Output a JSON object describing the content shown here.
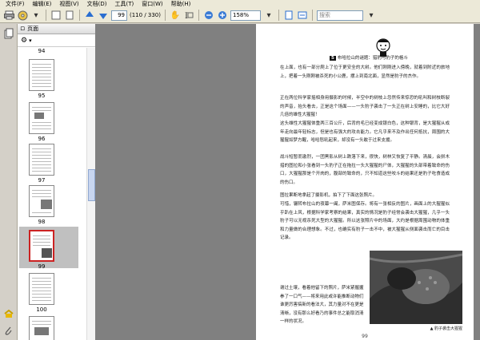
{
  "menu": [
    "文件(F)",
    "编辑(E)",
    "视图(V)",
    "文档(D)",
    "工具(T)",
    "窗口(W)",
    "帮助(H)"
  ],
  "toolbar": {
    "page_current": "99",
    "page_total": "(110 / 330)",
    "zoom": "158%",
    "search_placeholder": "搜索"
  },
  "panel": {
    "title": "页面"
  },
  "thumbnails": [
    {
      "label": "94"
    },
    {
      "label": "95"
    },
    {
      "label": "96"
    },
    {
      "label": "97"
    },
    {
      "label": "98"
    },
    {
      "label": "99",
      "selected": true
    },
    {
      "label": "100"
    }
  ],
  "doc": {
    "header_num": "5",
    "header_title": "布哈拉山的谜题：猎豹与豹子的格斗",
    "paragraphs": [
      "在上面，也有一部分爬上了位于更安全的大树。他们刚刚进入傍晚，就着到附近的旅地上，把着一头刚刚被杀死的小公鹿，摆上到南北面，显然是豹子的杰作。",
      "正在两位科学家摇相身用摄影的时候，半空中的树枝上忽然传来惊恐的吼叫和树枝断裂的声音，抬头看去，正是这个场面——一头豹子袭击了一头正在树上安睡的，比它大好几倍的雄性大猩猩！",
      "这头雄性大猩猩体重两三百公斤，后背的毛已经变成银白色，这种银背，是大猩猩从成年走向最年轻标志，但是也有强大的攻击能力。它凡乎来不及作出任何抵抗，周围的大猩猩如梦方醒，哈哈怒吼起来，却没有一头敢于过来支援。",
      "战斗短暂而激烈，一团黑影从树上跌落下来，很快，树林又恢复了平静。清晨，会拼木措的图拉和小张看到一头豹子正在拖拉一头大猩猩的尸体，大猩猩的头部带着致命的伤口，大猩猩那是个开肉的，腹部的致命的，只不知道这些咬斗的结果还是豹子吃食造成的伤口。",
      "图拉果断地拿起了摄影机，拍下了下面这张照片。",
      "可惜，辗转布拉山的夜幕一阖，萨米图保存。将有一张相反的图片，画面上的大猩猩似乎趴在上风，根据科学家考察的结果，真实的情况是豹子经常会袭击大猩猩，几乎一头豹子可以无视杀死大型的大猩猩。所以这张照片中的场面，大约是根据周围动物的体重和力量做的合理想象。不过，也确实有豹子一击不中，被大猩猩从侧面袭击而亡的目击记录。"
    ],
    "left_wrap": "谢过土壤，看着他留下的照片，萨米紧握握拳了一口气——将来用此或许能推断动物们谁更厉害搞新的看法大，其力量对不在更是清晰，没有那么好看乃的事件总之能取消清一样的状况。",
    "caption": "▲ 豹子袭击大猩猩",
    "page_number": "99"
  }
}
